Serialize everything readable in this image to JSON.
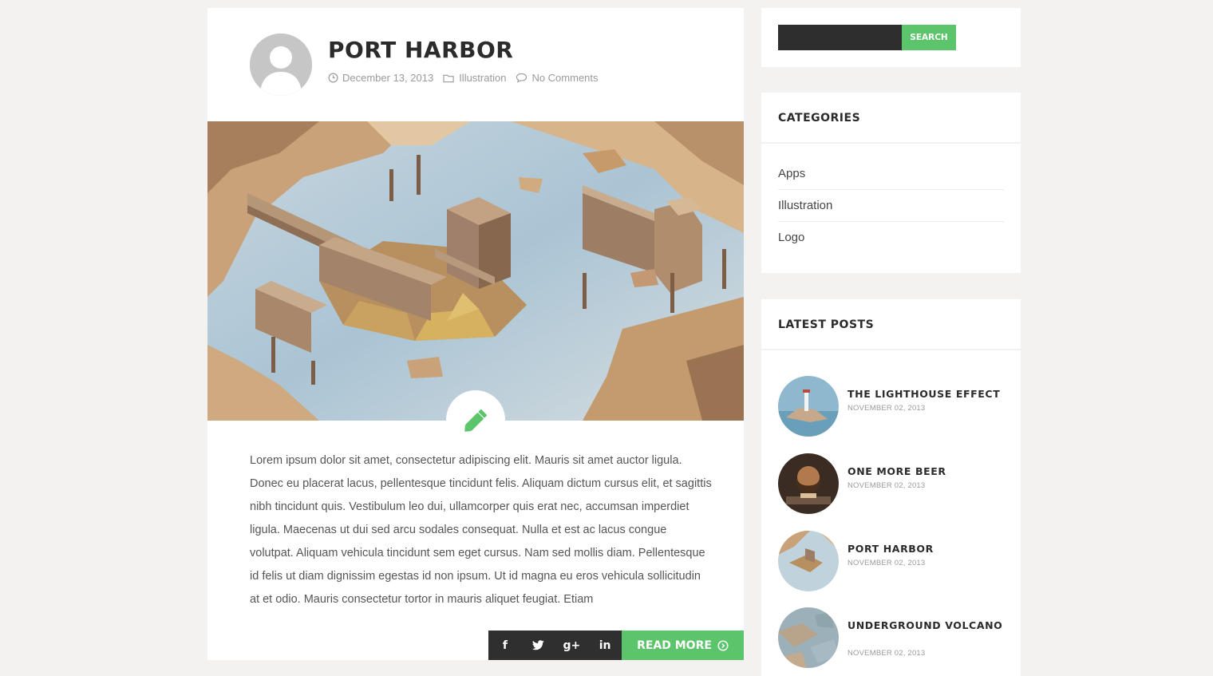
{
  "post": {
    "title": "PORT HARBOR",
    "date": "December 13, 2013",
    "category": "Illustration",
    "comments": "No Comments",
    "excerpt": "Lorem ipsum dolor sit amet, consectetur adipiscing elit. Mauris sit amet auctor ligula. Donec eu placerat lacus, pellentesque tincidunt felis. Aliquam dictum cursus elit, et sagittis nibh tincidunt quis. Vestibulum leo dui, ullamcorper quis erat nec, accumsan imperdiet ligula. Maecenas ut dui sed arcu sodales consequat. Nulla et est ac lacus congue volutpat. Aliquam vehicula tincidunt sem eget cursus. Nam sed mollis diam. Pellentesque id felis ut diam dignissim egestas id non ipsum. Ut id magna eu eros vehicula sollicitudin at et odio. Mauris consectetur tortor in mauris aliquet feugiat. Etiam",
    "read_more": "READ MORE",
    "share": {
      "facebook": "f",
      "twitter": "twitter-icon",
      "google": "g+",
      "linkedin": "in"
    }
  },
  "sidebar": {
    "search": {
      "button": "SEARCH",
      "value": ""
    },
    "categories": {
      "title": "CATEGORIES",
      "items": [
        "Apps",
        "Illustration",
        "Logo"
      ]
    },
    "latest": {
      "title": "LATEST POSTS",
      "items": [
        {
          "title": "THE LIGHTHOUSE EFFECT",
          "date": "NOVEMBER 02, 2013"
        },
        {
          "title": "ONE MORE BEER",
          "date": "NOVEMBER 02, 2013"
        },
        {
          "title": "PORT HARBOR",
          "date": "NOVEMBER 02, 2013"
        },
        {
          "title": "UNDERGROUND VOLCANO",
          "date": "NOVEMBER 02, 2013"
        }
      ]
    }
  },
  "colors": {
    "accent": "#5cc46a",
    "dark": "#2f2f2f",
    "background": "#f3f2f0"
  },
  "icons": [
    "clock-icon",
    "folder-icon",
    "comment-icon",
    "pencil-icon",
    "arrow-circle-icon",
    "facebook-icon",
    "twitter-icon",
    "google-plus-icon",
    "linkedin-icon"
  ]
}
